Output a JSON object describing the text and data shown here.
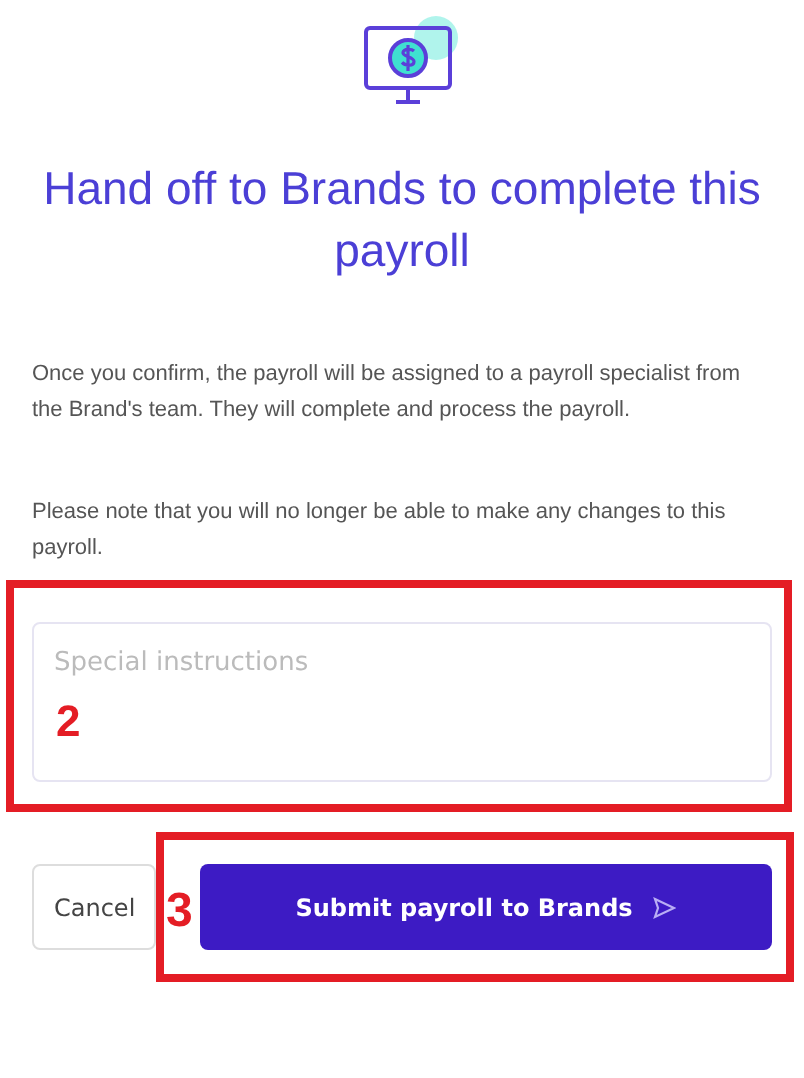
{
  "dialog": {
    "title": "Hand off to Brands to complete this payroll",
    "paragraphs": [
      "Once you confirm, the payroll will be assigned to a payroll specialist from the Brand's team. They will complete and process the payroll.",
      "Please note that you will no longer be able to make any changes to this payroll."
    ],
    "instructions_field": {
      "placeholder": "Special instructions"
    },
    "buttons": [
      {
        "kind": "secondary",
        "label": "Cancel"
      },
      {
        "kind": "primary",
        "label": "Submit payroll to Brands"
      }
    ]
  },
  "annotations": [
    {
      "label": "2"
    },
    {
      "label": "3"
    }
  ]
}
